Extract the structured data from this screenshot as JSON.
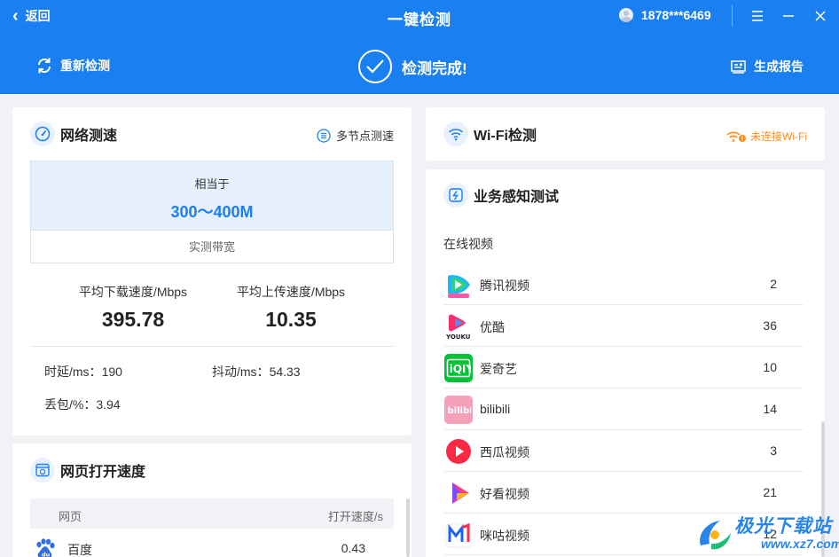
{
  "header": {
    "back_label": "返回",
    "title": "一键检测",
    "account": "1878***6469",
    "recheck_label": "重新检测",
    "status_label": "检测完成!",
    "report_label": "生成报告",
    "accent_color": "#1a7ff0"
  },
  "network_speed": {
    "title": "网络测速",
    "multi_node_label": "多节点测速",
    "equivalent_label": "相当于",
    "equivalent_value": "300～400M",
    "measured_bandwidth_label": "实测带宽",
    "download_label": "平均下载速度/Mbps",
    "download_value": "395.78",
    "upload_label": "平均上传速度/Mbps",
    "upload_value": "10.35",
    "latency_label": "时延/ms：",
    "latency_value": "190",
    "jitter_label": "抖动/ms：",
    "jitter_value": "54.33",
    "loss_label": "丢包/%：",
    "loss_value": "3.94"
  },
  "webpage_speed": {
    "title": "网页打开速度",
    "col_page": "网页",
    "col_speed": "打开速度/s",
    "rows": [
      {
        "name": "百度",
        "value": "0.43",
        "icon": "baidu-icon"
      }
    ]
  },
  "wifi": {
    "title": "Wi-Fi检测",
    "status": "未连接Wi-Fi",
    "status_color": "#ff8c1a"
  },
  "service_test": {
    "title": "业务感知测试",
    "section": "在线视频",
    "rows": [
      {
        "name": "腾讯视频",
        "value": "2",
        "icon": "tencent-video-icon"
      },
      {
        "name": "优酷",
        "value": "36",
        "icon": "youku-icon"
      },
      {
        "name": "爱奇艺",
        "value": "10",
        "icon": "iqiyi-icon"
      },
      {
        "name": "bilibili",
        "value": "14",
        "icon": "bilibili-icon"
      },
      {
        "name": "西瓜视频",
        "value": "3",
        "icon": "xigua-video-icon"
      },
      {
        "name": "好看视频",
        "value": "21",
        "icon": "haokan-video-icon"
      },
      {
        "name": "咪咕视频",
        "value": "12",
        "icon": "migu-video-icon"
      }
    ]
  },
  "watermark": {
    "line1": "极光下载站",
    "line2": "www.xz7.com"
  }
}
